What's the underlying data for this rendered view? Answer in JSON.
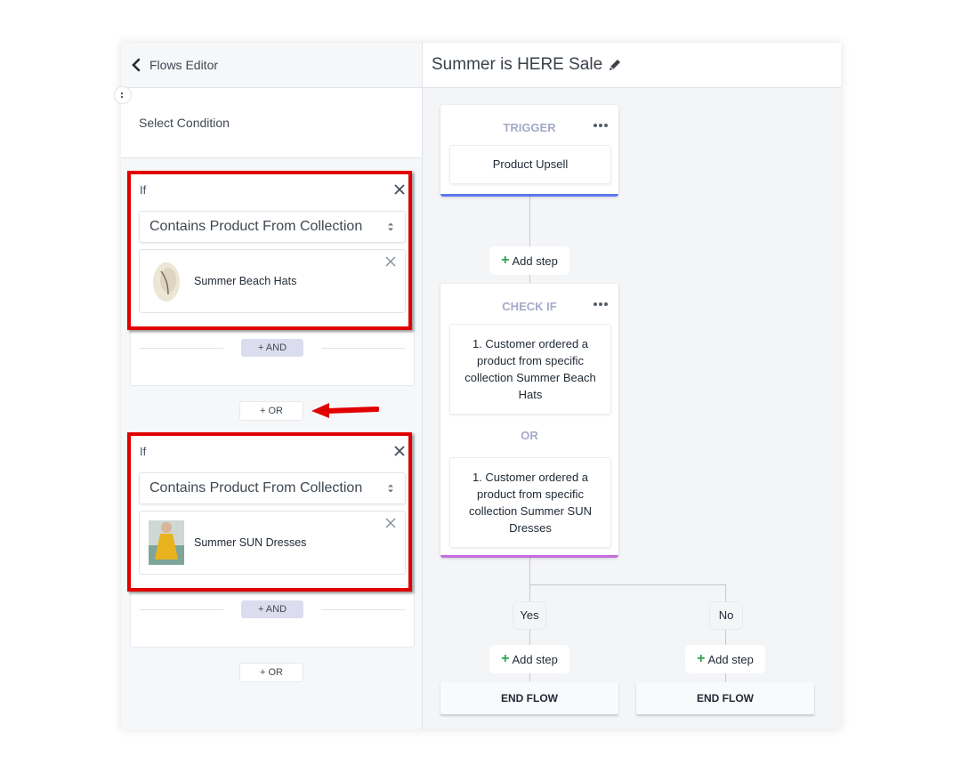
{
  "left_panel": {
    "back_label": "Flows Editor",
    "section_title": "Select Condition",
    "condition_groups": [
      {
        "if_label": "If",
        "condition_select": "Contains Product From Collection",
        "collection": {
          "name": "Summer Beach Hats",
          "thumbnail": "sun-hat-image"
        },
        "and_label": "+ AND"
      },
      {
        "if_label": "If",
        "condition_select": "Contains Product From Collection",
        "collection": {
          "name": "Summer SUN Dresses",
          "thumbnail": "yellow-dress-image"
        },
        "and_label": "+ AND"
      }
    ],
    "or_label": "+ OR",
    "annotation_color": "#e10000"
  },
  "right_panel": {
    "flow_title": "Summer is HERE Sale",
    "trigger": {
      "title": "TRIGGER",
      "value": "Product Upsell",
      "accent": "#5c78f0"
    },
    "add_step_label": "Add step",
    "check_if": {
      "title": "CHECK IF",
      "conditions": [
        "1. Customer ordered a product from specific collection  Summer Beach Hats",
        "1. Customer ordered a product from specific collection  Summer SUN Dresses"
      ],
      "separator": "OR",
      "accent": "#c46ddc"
    },
    "branches": [
      {
        "label": "Yes",
        "add_step_label": "Add step",
        "end_label": "END FLOW"
      },
      {
        "label": "No",
        "add_step_label": "Add step",
        "end_label": "END FLOW"
      }
    ]
  }
}
